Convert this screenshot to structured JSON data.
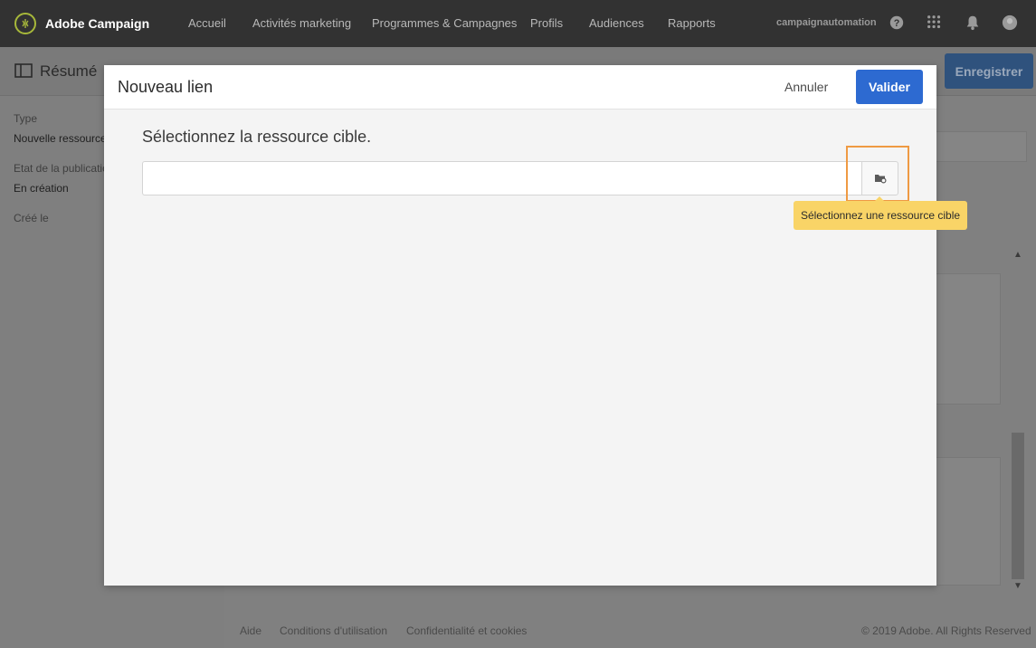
{
  "app": {
    "brand": "Adobe Campaign"
  },
  "nav": {
    "items": [
      {
        "label": "Accueil"
      },
      {
        "label": "Activités marketing"
      },
      {
        "label": "Programmes & Campagnes"
      },
      {
        "label": "Profils"
      },
      {
        "label": "Audiences"
      },
      {
        "label": "Rapports"
      }
    ],
    "user": "campaignautomation",
    "icons": [
      "help-icon",
      "apps-grid-icon",
      "notification-bell-icon",
      "user-avatar-icon"
    ]
  },
  "page": {
    "summary_title": "Résumé",
    "register_label": "Enregistrer",
    "meta": {
      "type_label": "Type",
      "type_value": "Nouvelle ressource",
      "status_label": "Etat de la publication",
      "status_value": "En création",
      "created_label": "Créé le"
    }
  },
  "footer": {
    "links": [
      "Aide",
      "Conditions d'utilisation",
      "Confidentialité et cookies"
    ],
    "copyright": "© 2019 Adobe. All Rights Reserved"
  },
  "modal": {
    "title": "Nouveau lien",
    "cancel_label": "Annuler",
    "validate_label": "Valider",
    "field_label": "Sélectionnez la ressource cible.",
    "input_value": "",
    "tooltip": "Sélectionnez une ressource cible"
  },
  "colors": {
    "nav_bg": "#323232",
    "primary": "#2d6ad1",
    "highlight": "#ef9a43",
    "tooltip_bg": "#f9d467"
  }
}
